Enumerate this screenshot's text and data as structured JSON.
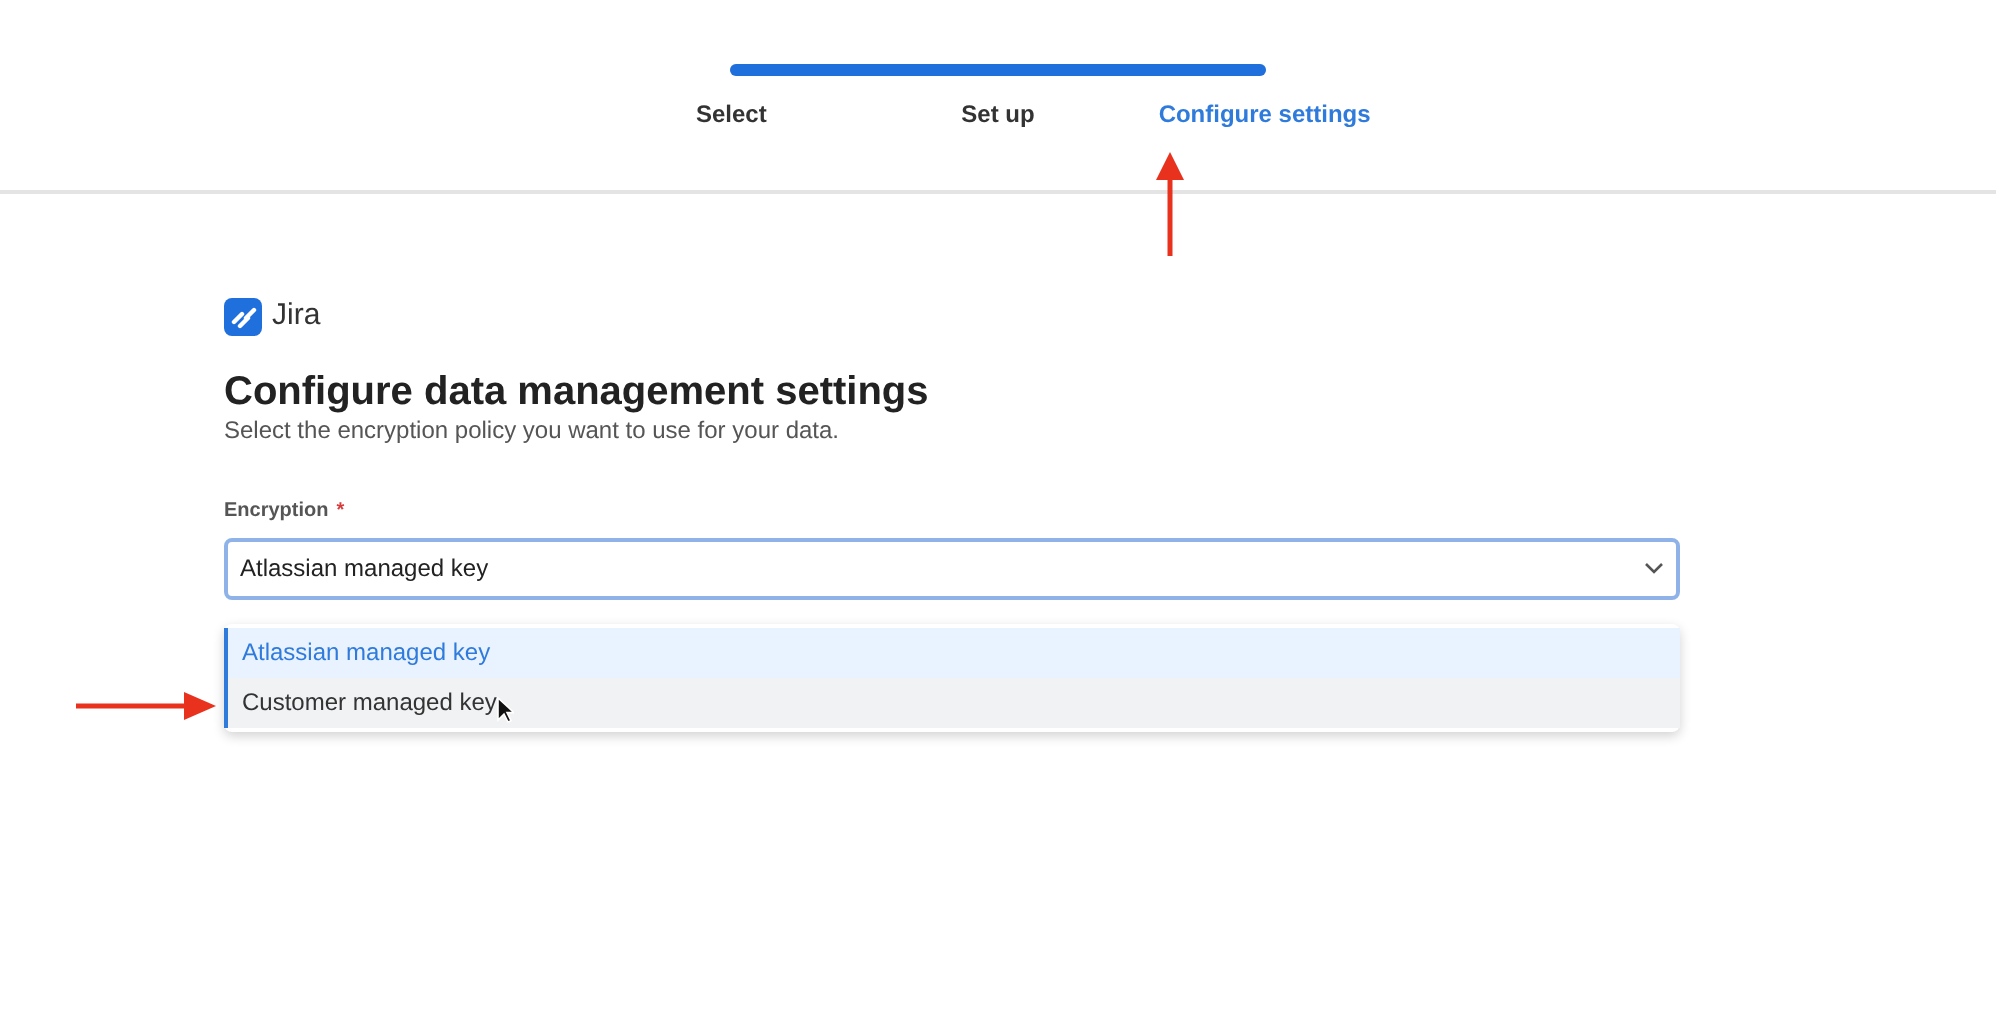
{
  "stepper": {
    "level": 1,
    "steps": [
      {
        "label": "Select",
        "selected": false
      },
      {
        "label": "Set up",
        "selected": false
      },
      {
        "label": "Configure settings",
        "selected": true
      }
    ]
  },
  "product": {
    "name": "Jira"
  },
  "heading": "Configure data management settings",
  "description": "Select the encryption policy you want to use for your data.",
  "encryption": {
    "label": "Encryption",
    "required_mark": "*",
    "value": "Atlassian managed key",
    "expanded": true,
    "options": [
      {
        "label": "Atlassian managed key",
        "selected": true,
        "hovered": false
      },
      {
        "label": "Customer managed key",
        "selected": false,
        "hovered": true
      }
    ]
  }
}
